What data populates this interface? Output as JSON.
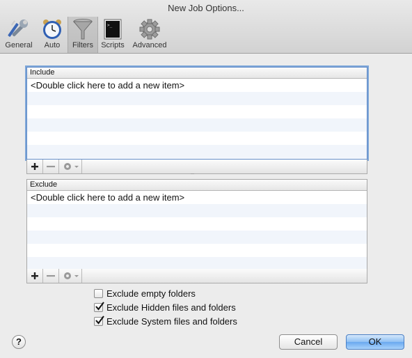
{
  "window": {
    "title": "New Job Options..."
  },
  "toolbar": {
    "items": [
      {
        "label": "General",
        "icon": "wrench-screwdriver-icon"
      },
      {
        "label": "Auto",
        "icon": "alarm-clock-icon"
      },
      {
        "label": "Filters",
        "icon": "funnel-icon",
        "selected": true
      },
      {
        "label": "Scripts",
        "icon": "terminal-icon"
      },
      {
        "label": "Advanced",
        "icon": "gear-icon"
      }
    ]
  },
  "include": {
    "header": "Include",
    "placeholder_row": "<Double click here to add a new item>"
  },
  "exclude": {
    "header": "Exclude",
    "placeholder_row": "<Double click here to add a new item>"
  },
  "options": {
    "empty_folders": {
      "label": "Exclude empty folders",
      "checked": false
    },
    "hidden_files": {
      "label": "Exclude Hidden files and folders",
      "checked": true
    },
    "system_files": {
      "label": "Exclude System files and folders",
      "checked": true
    }
  },
  "buttons": {
    "help": "?",
    "cancel": "Cancel",
    "ok": "OK"
  },
  "colors": {
    "focus_ring": "#7ea6d8",
    "stripe": "#f1f5fb",
    "default_button": "#6aa9ef"
  }
}
